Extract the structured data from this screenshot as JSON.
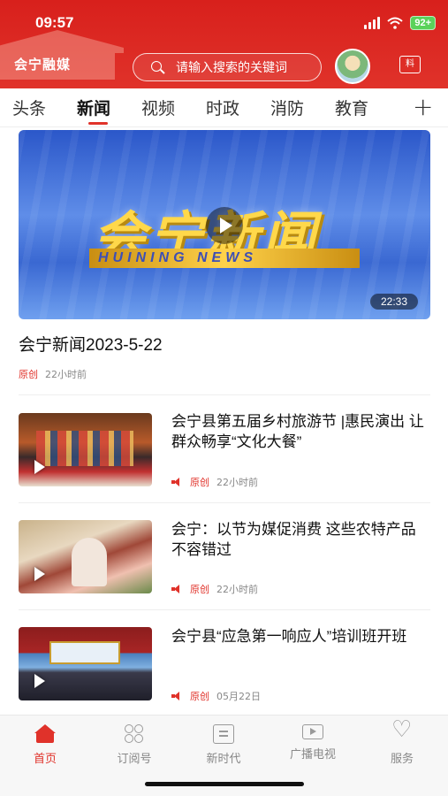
{
  "status_bar": {
    "time": "09:57",
    "battery": "92+"
  },
  "header": {
    "app_name": "会宁融媒",
    "search_placeholder": "请输入搜索的关键词",
    "report_label": "料"
  },
  "tabs": [
    {
      "label": "头条",
      "active": false
    },
    {
      "label": "新闻",
      "active": true
    },
    {
      "label": "视频",
      "active": false
    },
    {
      "label": "时政",
      "active": false
    },
    {
      "label": "消防",
      "active": false
    },
    {
      "label": "教育",
      "active": false
    }
  ],
  "tabs_more": "+",
  "featured": {
    "banner_cn": "会宁新闻",
    "banner_en": "HUINING NEWS",
    "duration": "22:33",
    "title": "会宁新闻2023-5-22",
    "tag": "原创",
    "time": "22小时前"
  },
  "news": [
    {
      "title": "会宁县第五届乡村旅游节 |惠民演出 让群众畅享“文化大餐”",
      "tag": "原创",
      "time": "22小时前"
    },
    {
      "title": "会宁：以节为媒促消费  这些农特产品不容错过",
      "tag": "原创",
      "time": "22小时前"
    },
    {
      "title": "会宁县“应急第一响应人”培训班开班",
      "tag": "原创",
      "time": "05月22日"
    }
  ],
  "bottom_nav": [
    {
      "label": "首页",
      "icon": "home-icon",
      "active": true
    },
    {
      "label": "订阅号",
      "icon": "subscribe-icon",
      "active": false
    },
    {
      "label": "新时代",
      "icon": "document-icon",
      "active": false
    },
    {
      "label": "广播电视",
      "icon": "tv-icon",
      "active": false
    },
    {
      "label": "服务",
      "icon": "heart-icon",
      "active": false
    }
  ],
  "colors": {
    "brand_red": "#e0322a",
    "inactive": "#888888"
  }
}
